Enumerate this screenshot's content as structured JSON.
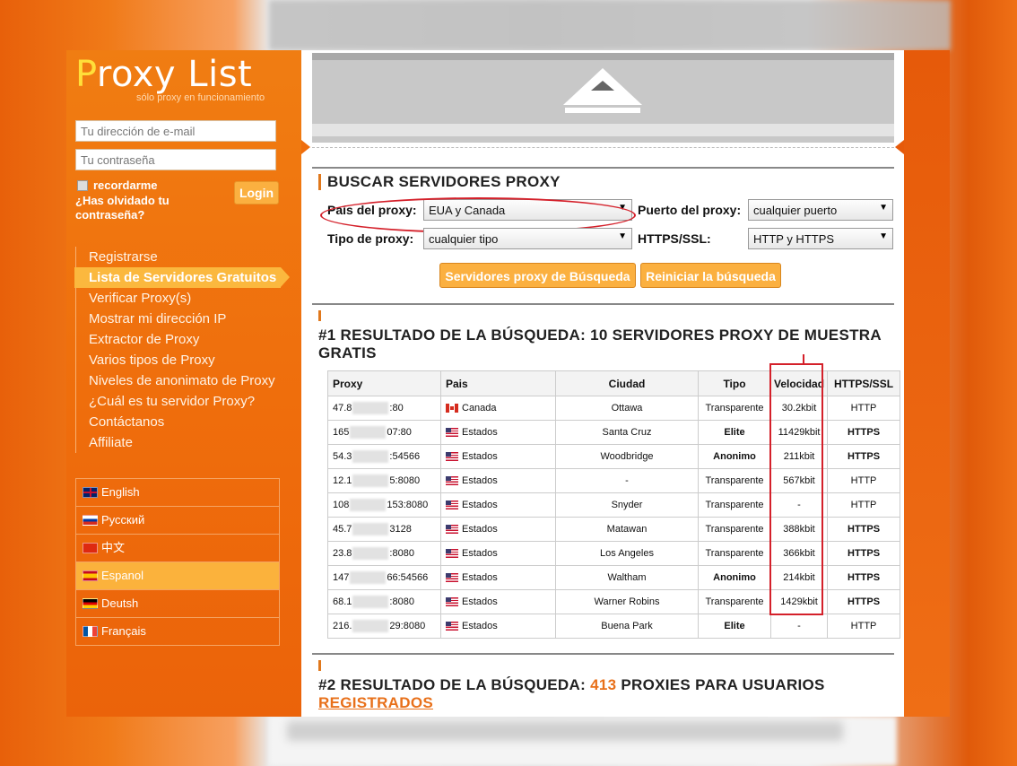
{
  "logo": {
    "proxy_p": "P",
    "proxy_rest": "roxy List",
    "subtitle": "sólo proxy en funcionamiento"
  },
  "login": {
    "email_placeholder": "Tu dirección de e-mail",
    "password_placeholder": "Tu contraseña",
    "remember_label": "recordarme",
    "forgot_label": "¿Has olvidado tu contraseña?",
    "login_button": "Login"
  },
  "nav": {
    "items": [
      {
        "label": "Registrarse"
      },
      {
        "label": "Lista de Servidores Gratuitos",
        "active": true
      },
      {
        "label": "Verificar Proxy(s)"
      },
      {
        "label": "Mostrar mi dirección IP"
      },
      {
        "label": "Extractor de Proxy"
      },
      {
        "label": "Varios tipos de Proxy"
      },
      {
        "label": "Niveles de anonimato de Proxy"
      },
      {
        "label": "¿Cuál es tu servidor Proxy?"
      },
      {
        "label": "Contáctanos"
      },
      {
        "label": "Affiliate"
      }
    ]
  },
  "languages": {
    "items": [
      {
        "label": "English",
        "flag": "uk-flag"
      },
      {
        "label": "Русский",
        "flag": "russia-flag"
      },
      {
        "label": "中文",
        "flag": "china-flag"
      },
      {
        "label": "Espanol",
        "flag": "spain-flag",
        "active": true
      },
      {
        "label": "Deutsh",
        "flag": "germany-flag"
      },
      {
        "label": "Français",
        "flag": "france-flag"
      }
    ]
  },
  "search": {
    "title": "BUSCAR SERVIDORES PROXY",
    "country_label": "País del proxy:",
    "country_value": "EUA y Canada",
    "port_label": "Puerto del proxy:",
    "port_value": "cualquier puerto",
    "type_label": "Tipo de proxy:",
    "type_value": "cualquier tipo",
    "ssl_label": "HTTPS/SSL:",
    "ssl_value": "HTTP y HTTPS",
    "search_button": "Servidores proxy de Búsqueda",
    "reset_button": "Reiniciar la búsqueda"
  },
  "results1": {
    "title_line1": "#1 RESULTADO DE LA BÚSQUEDA: 10 SERVIDORES PROXY DE MUESTRA",
    "title_line2": "GRATIS",
    "columns": [
      "Proxy",
      "Pais",
      "Ciudad",
      "Tipo",
      "Velocidad",
      "HTTPS/SSL"
    ],
    "rows": [
      {
        "ip_start": "47.8",
        "ip_end": ":80",
        "flag": "canada-flag",
        "country": "Canada",
        "city": "Ottawa",
        "type": "Transparente",
        "type_bold": false,
        "speed": "30.2kbit",
        "ssl": "HTTP",
        "ssl_bold": false
      },
      {
        "ip_start": "165",
        "ip_end": "07:80",
        "flag": "usa-flag",
        "country": "Estados",
        "city": "Santa Cruz",
        "type": "Elite",
        "type_bold": true,
        "speed": "11429kbit",
        "ssl": "HTTPS",
        "ssl_bold": true
      },
      {
        "ip_start": "54.3",
        "ip_end": ":54566",
        "flag": "usa-flag",
        "country": "Estados",
        "city": "Woodbridge",
        "type": "Anonimo",
        "type_bold": true,
        "speed": "211kbit",
        "ssl": "HTTPS",
        "ssl_bold": true
      },
      {
        "ip_start": "12.1",
        "ip_end": "5:8080",
        "flag": "usa-flag",
        "country": "Estados",
        "city": "-",
        "type": "Transparente",
        "type_bold": false,
        "speed": "567kbit",
        "ssl": "HTTP",
        "ssl_bold": false
      },
      {
        "ip_start": "108",
        "ip_end": "153:8080",
        "flag": "usa-flag",
        "country": "Estados",
        "city": "Snyder",
        "type": "Transparente",
        "type_bold": false,
        "speed": "-",
        "ssl": "HTTP",
        "ssl_bold": false
      },
      {
        "ip_start": "45.7",
        "ip_end": "3128",
        "flag": "usa-flag",
        "country": "Estados",
        "city": "Matawan",
        "type": "Transparente",
        "type_bold": false,
        "speed": "388kbit",
        "ssl": "HTTPS",
        "ssl_bold": true
      },
      {
        "ip_start": "23.8",
        "ip_end": ":8080",
        "flag": "usa-flag",
        "country": "Estados",
        "city": "Los Angeles",
        "type": "Transparente",
        "type_bold": false,
        "speed": "366kbit",
        "ssl": "HTTPS",
        "ssl_bold": true
      },
      {
        "ip_start": "147",
        "ip_end": "66:54566",
        "flag": "usa-flag",
        "country": "Estados",
        "city": "Waltham",
        "type": "Anonimo",
        "type_bold": true,
        "speed": "214kbit",
        "ssl": "HTTPS",
        "ssl_bold": true
      },
      {
        "ip_start": "68.1",
        "ip_end": ":8080",
        "flag": "usa-flag",
        "country": "Estados",
        "city": "Warner Robins",
        "type": "Transparente",
        "type_bold": false,
        "speed": "1429kbit",
        "ssl": "HTTPS",
        "ssl_bold": true
      },
      {
        "ip_start": "216.",
        "ip_end": "29:8080",
        "flag": "usa-flag",
        "country": "Estados",
        "city": "Buena Park",
        "type": "Elite",
        "type_bold": true,
        "speed": "-",
        "ssl": "HTTP",
        "ssl_bold": false
      }
    ]
  },
  "results2": {
    "title_prefix": "#2 RESULTADO DE LA BÚSQUEDA: ",
    "count": "413",
    "title_suffix": " PROXIES PARA USUARIOS",
    "link": "REGISTRADOS"
  },
  "colors": {
    "accent": "#ef6d0c",
    "button": "#fbb040",
    "highlight": "#d4202a"
  }
}
